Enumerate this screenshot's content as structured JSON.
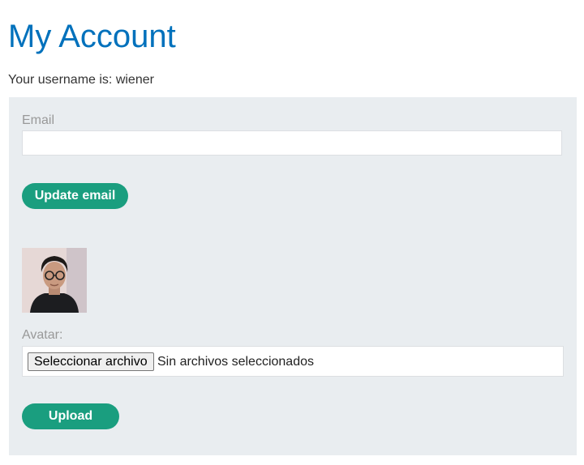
{
  "page": {
    "title": "My Account",
    "username_line": "Your username is: wiener"
  },
  "email_form": {
    "label": "Email",
    "value": "",
    "button_label": "Update email"
  },
  "avatar_form": {
    "label": "Avatar:",
    "file_button_label": "Seleccionar archivo",
    "file_status": "Sin archivos seleccionados",
    "upload_label": "Upload"
  },
  "colors": {
    "title": "#0071bc",
    "button": "#1a9e7f",
    "panel": "#e9edf0"
  }
}
